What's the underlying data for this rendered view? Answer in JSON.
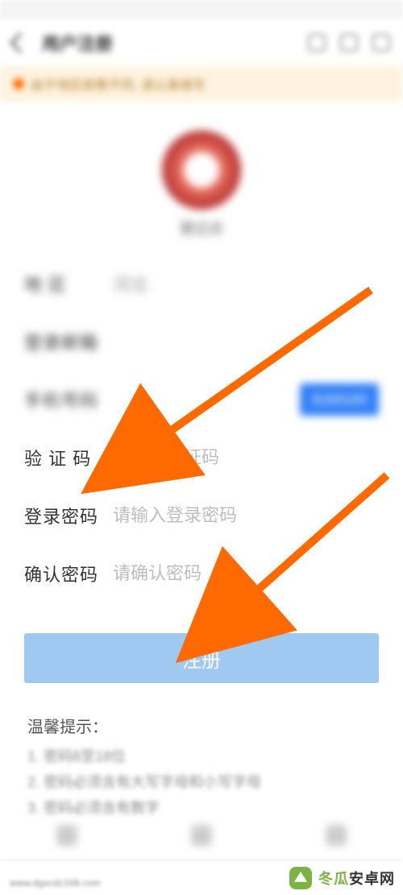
{
  "header": {
    "title": "用户注册"
  },
  "banner": {
    "text": "由于地区政策不同, 请认真填写"
  },
  "avatar": {
    "name": "登记点"
  },
  "form": {
    "field1_label": "地   区",
    "field1_value": "河北",
    "field2_label": "登录邮箱",
    "field2_value": "",
    "field3_label": "手机号码",
    "field3_value": "",
    "sms_button": "发送验证码",
    "verify_label": "验 证 码",
    "verify_placeholder": "请输入验证码",
    "password_label": "登录密码",
    "password_placeholder": "请输入登录密码",
    "confirm_label": "确认密码",
    "confirm_placeholder": "请确认密码"
  },
  "submit": {
    "label": "注册"
  },
  "tips": {
    "title": "温馨提示：",
    "items": [
      "密码8至18位",
      "密码必须含有大写字母和小写字母",
      "密码必须含有数字"
    ]
  },
  "watermark": {
    "brand_a": "冬瓜",
    "brand_b": "安卓网",
    "url": "www.dgxcdz168.com"
  }
}
